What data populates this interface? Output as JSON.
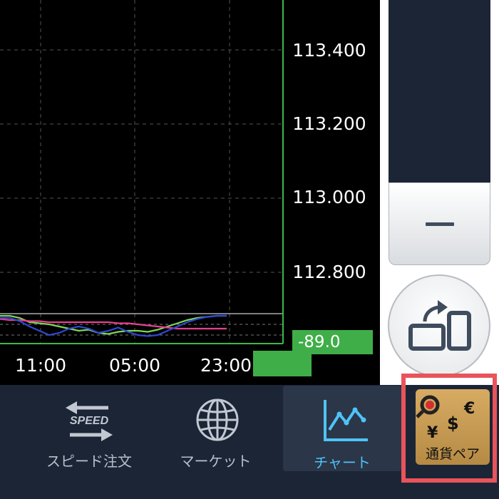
{
  "chart": {
    "y_ticks": [
      "113.400",
      "113.200",
      "113.000",
      "112.800"
    ],
    "x_ticks": [
      "11:00",
      "05:00",
      "23:00"
    ],
    "price_badge": "-89.0"
  },
  "chart_data": {
    "type": "line",
    "title": "",
    "xlabel": "",
    "ylabel": "",
    "x_ticks": [
      "11:00",
      "05:00",
      "23:00"
    ],
    "y_ticks": [
      113.4,
      113.2,
      113.0,
      112.8
    ],
    "grid": true,
    "indicator_value": -89.0,
    "series": [
      {
        "color": "#7cd65a",
        "values": [
          8,
          8,
          6,
          2,
          1,
          0,
          -2,
          -4,
          -6,
          -5,
          -8,
          -9,
          -7,
          -6,
          -6,
          -7,
          -5,
          -2,
          1,
          4,
          6,
          7,
          8,
          8
        ]
      },
      {
        "color": "#e8418f",
        "values": [
          5,
          4,
          4,
          3,
          3,
          2,
          2,
          2,
          2,
          2,
          2,
          2,
          1,
          1,
          0,
          -1,
          -2,
          -3,
          -4,
          -4,
          -4,
          -4,
          -4,
          -4
        ]
      },
      {
        "color": "#2f49d6",
        "values": [
          6,
          6,
          3,
          -2,
          -6,
          -10,
          -8,
          -4,
          -2,
          -4,
          -8,
          -6,
          -3,
          -7,
          -10,
          -11,
          -10,
          -6,
          -2,
          2,
          5,
          7,
          8,
          8
        ]
      }
    ],
    "colors": {
      "grid": "#555555",
      "axis": "#3cb84a",
      "badge": "#3fae49",
      "background": "#000000"
    }
  },
  "nav": {
    "speed_icon_text": "SPEED",
    "speed_label": "スピード注文",
    "market_label": "マーケット",
    "chart_label": "チャート",
    "currency_label": "通貨ペア",
    "currency_symbols": {
      "euro": "€",
      "dollar": "$",
      "yen": "¥"
    }
  },
  "icons": {
    "speed": "speed-arrows-icon",
    "market": "globe-icon",
    "chart": "line-chart-icon",
    "currency": "currency-search-icon",
    "rotate": "rotate-screen-icon"
  },
  "colors": {
    "accent_active": "#4fc3f7",
    "nav_text": "#b9c0cb",
    "nav_background": "#1b2536",
    "highlight_border": "#e8545a"
  }
}
